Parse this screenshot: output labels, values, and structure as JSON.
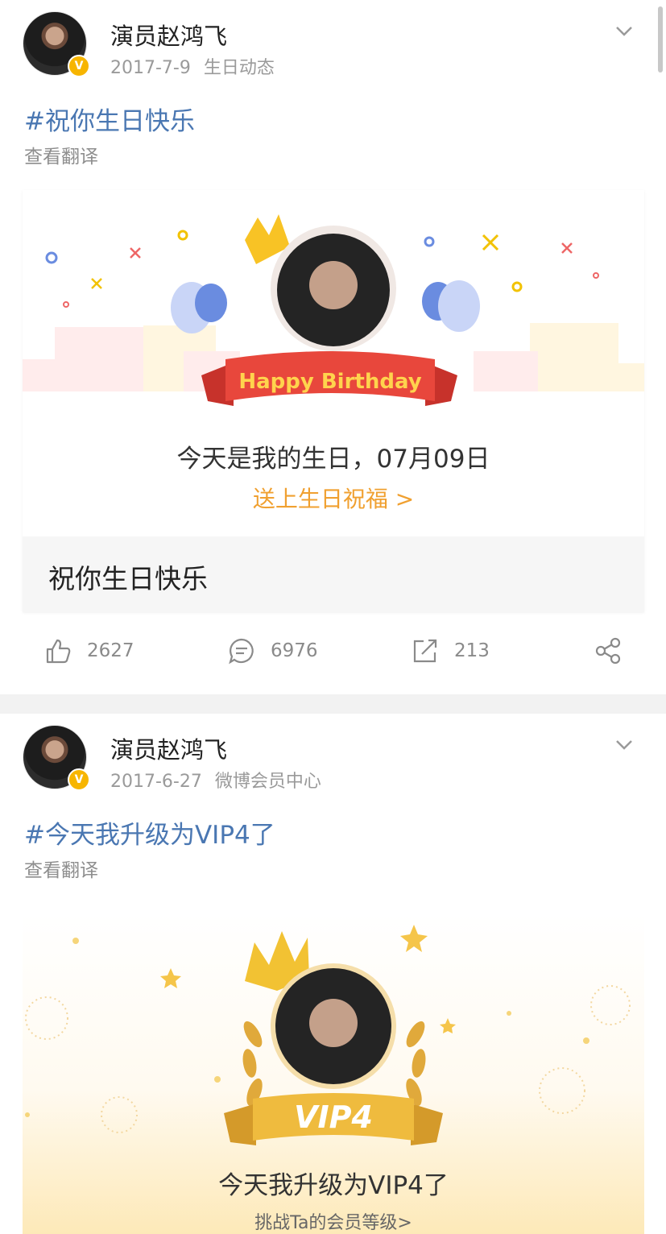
{
  "posts": [
    {
      "author": "演员赵鸿飞",
      "verified_badge": "V",
      "date": "2017-7-9",
      "source": "生日动态",
      "topic": "#祝你生日快乐",
      "translate_label": "查看翻译",
      "card": {
        "banner_text": "Happy Birthday",
        "headline": "今天是我的生日，07月09日",
        "cta": "送上生日祝福 >",
        "caption": "祝你生日快乐"
      },
      "actions": {
        "likes": "2627",
        "comments": "6976",
        "reposts": "213"
      }
    },
    {
      "author": "演员赵鸿飞",
      "verified_badge": "V",
      "date": "2017-6-27",
      "source": "微博会员中心",
      "topic": "#今天我升级为VIP4了",
      "translate_label": "查看翻译",
      "card": {
        "badge_text": "VIP4",
        "headline": "今天我升级为VIP4了",
        "cta": "挑战Ta的会员等级>"
      }
    }
  ],
  "colors": {
    "topic_link": "#4a77b2",
    "cta_orange": "#f0a030",
    "verified_gold": "#f7b500",
    "ribbon_red": "#e8473c"
  },
  "icons": [
    "chevron-down-icon",
    "like-icon",
    "comment-icon",
    "repost-icon",
    "share-icon",
    "verified-badge-icon"
  ]
}
